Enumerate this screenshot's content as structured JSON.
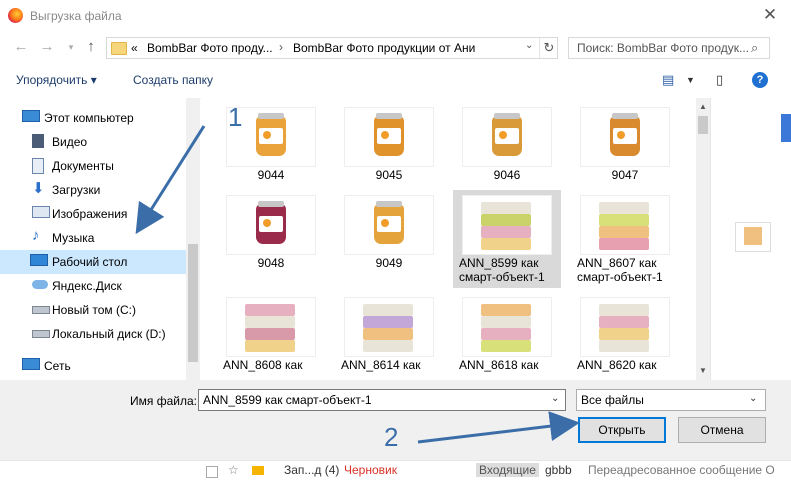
{
  "window": {
    "title": "Выгрузка файла"
  },
  "address": {
    "prefix": "«",
    "crumbs": [
      "BombBar Фото проду...",
      "BombBar Фото продукции от Ани"
    ],
    "search_placeholder": "Поиск: BombBar Фото продук..."
  },
  "toolbar": {
    "organize_label": "Упорядочить ▾",
    "new_folder_label": "Создать папку"
  },
  "sidebar": {
    "items": [
      {
        "label": "Этот компьютер",
        "icon": "computer-icon"
      },
      {
        "label": "Видео",
        "icon": "video-icon"
      },
      {
        "label": "Документы",
        "icon": "documents-icon"
      },
      {
        "label": "Загрузки",
        "icon": "downloads-icon"
      },
      {
        "label": "Изображения",
        "icon": "pictures-icon"
      },
      {
        "label": "Музыка",
        "icon": "music-icon"
      },
      {
        "label": "Рабочий стол",
        "icon": "desktop-icon",
        "selected": true
      },
      {
        "label": "Яндекс.Диск",
        "icon": "yandex-disk-icon"
      },
      {
        "label": "Новый том (C:)",
        "icon": "drive-icon"
      },
      {
        "label": "Локальный диск (D:)",
        "icon": "drive-icon"
      },
      {
        "label": "Сеть",
        "icon": "network-icon"
      }
    ]
  },
  "files": [
    {
      "name": "9044",
      "kind": "jar",
      "color": "#e9a33a"
    },
    {
      "name": "9045",
      "kind": "jar",
      "color": "#e0922b"
    },
    {
      "name": "9046",
      "kind": "jar",
      "color": "#d99a3a"
    },
    {
      "name": "9047",
      "kind": "jar",
      "color": "#d98a2f"
    },
    {
      "name": "9048",
      "kind": "jar",
      "color": "#9b2b4a"
    },
    {
      "name": "9049",
      "kind": "jar",
      "color": "#e5a33c"
    },
    {
      "name": "ANN_8599 как смарт-объект-1",
      "line1": "ANN_8599 как",
      "line2": "смарт-объект-1",
      "kind": "bar",
      "selected": true
    },
    {
      "name": "ANN_8607 как смарт-объект-1",
      "line1": "ANN_8607 как",
      "line2": "смарт-объект-1",
      "kind": "bar"
    },
    {
      "name": "ANN_8608 как",
      "line1": "ANN_8608 как",
      "line2": "",
      "kind": "bar"
    },
    {
      "name": "ANN_8614 как",
      "line1": "ANN_8614 как",
      "line2": "",
      "kind": "bar"
    },
    {
      "name": "ANN_8618 как",
      "line1": "ANN_8618 как",
      "line2": "",
      "kind": "bar"
    },
    {
      "name": "ANN_8620 как",
      "line1": "ANN_8620 как",
      "line2": "",
      "kind": "bar"
    }
  ],
  "filename": {
    "label": "Имя файла:",
    "value": "ANN_8599 как смарт-объект-1"
  },
  "filetype": {
    "value": "Все файлы"
  },
  "buttons": {
    "open": "Открыть",
    "cancel": "Отмена"
  },
  "background": {
    "row": [
      "Зап...д (4)",
      "Черновик",
      "Входящие",
      "gbbb",
      "Переадресованное сообщение О"
    ]
  },
  "annotations": {
    "step1": "1",
    "step2": "2"
  },
  "colors": {
    "accent": "#0078d7",
    "arrow": "#3b6ea8",
    "selection": "#cce8ff"
  }
}
